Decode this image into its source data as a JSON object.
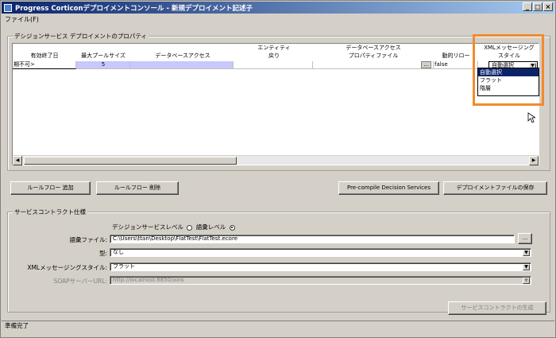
{
  "window": {
    "title": "Progress Corticonデプロイメントコンソール - 新規デプロイメント記述子"
  },
  "menu": {
    "file": "ファイル(F)"
  },
  "deploy_props": {
    "group_title": "デシジョンサービス デプロイメントのプロパティ",
    "headers": {
      "expiry": "有効終了日",
      "max_pool": "最大プールサイズ",
      "db_access": "データベースアクセス",
      "entity_top": "エンティティ",
      "entity_bottom": "戻り",
      "dbprops_top": "データベースアクセス",
      "dbprops_bottom": "プロパティファイル",
      "dynamic": "動的リロー",
      "xml_top": "XMLメッセージング",
      "xml_bottom": "スタイル"
    },
    "row": {
      "expiry": "期不可>",
      "max_pool": "5",
      "dots": "...",
      "dynamic": "false",
      "xml_style": "自動選択"
    },
    "dropdown_options": [
      "自動選択",
      "フラット",
      "階層"
    ]
  },
  "buttons": {
    "add_ruleflow": "ルールフロー 追加",
    "remove_ruleflow": "ルールフロー 削除",
    "precompile": "Pre-compile Decision Services",
    "save_deploy": "デプロイメントファイルの保存",
    "generate_contract": "サービスコントラクトの生成"
  },
  "contract": {
    "group_title": "サービスコントラクト仕様",
    "level_label": "デシジョンサービスレベル",
    "vocab_level_label": "語彙レベル",
    "vocab_file_label": "語彙ファイル:",
    "vocab_file_value": "C:\\Users\\ttan\\Desktop\\FlatTest\\FlatTest.ecore",
    "type_label": "型:",
    "type_value": "なし",
    "xml_style_label": "XMLメッセージングスタイル:",
    "xml_style_value": "フラット",
    "soap_label": "SOAPサーバーURL:",
    "soap_value": "http://localhost:8850/axis"
  },
  "status": "準備完了"
}
